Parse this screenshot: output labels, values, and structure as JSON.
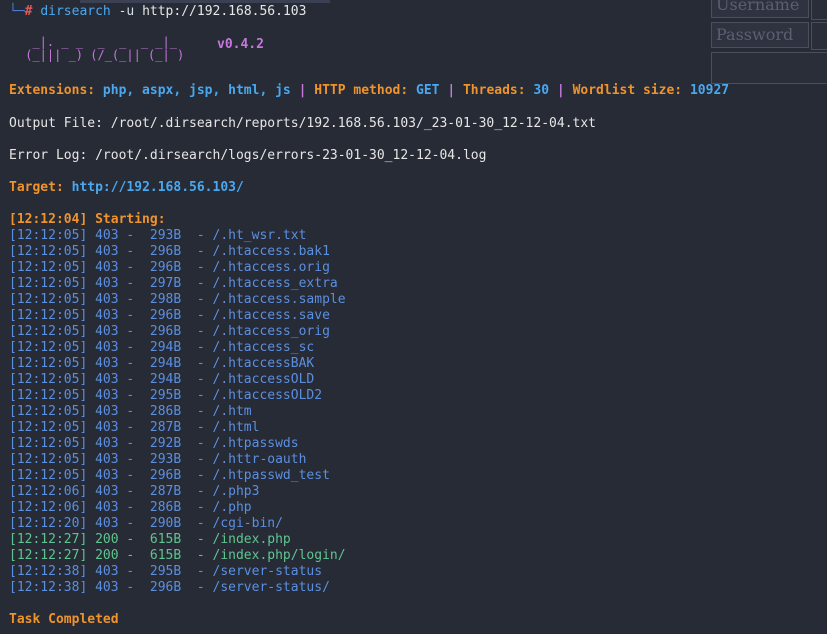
{
  "prompt": {
    "command": "dirsearch",
    "flag": "-u",
    "url": "http://192.168.56.103"
  },
  "banner": {
    "logo_line1": "  _|. _ _  _  _  _ _|_",
    "logo_line2": " (_||| _) (/_(_|| (_| )",
    "version": "v0.4.2"
  },
  "config": {
    "extensions_label": "Extensions:",
    "extensions_value": "php, aspx, jsp, html, js",
    "method_label": "HTTP method:",
    "method_value": "GET",
    "threads_label": "Threads:",
    "threads_value": "30",
    "wordlist_label": "Wordlist size:",
    "wordlist_value": "10927",
    "separator": "|"
  },
  "output_file": "Output File: /root/.dirsearch/reports/192.168.56.103/_23-01-30_12-12-04.txt",
  "error_log": "Error Log: /root/.dirsearch/logs/errors-23-01-30_12-12-04.log",
  "target": {
    "label": "Target:",
    "url": "http://192.168.56.103/"
  },
  "starting": "[12:12:04] Starting:",
  "results": [
    {
      "text": "[12:12:05] 403 -  293B  - /.ht_wsr.txt",
      "status": "403"
    },
    {
      "text": "[12:12:05] 403 -  296B  - /.htaccess.bak1",
      "status": "403"
    },
    {
      "text": "[12:12:05] 403 -  296B  - /.htaccess.orig",
      "status": "403"
    },
    {
      "text": "[12:12:05] 403 -  297B  - /.htaccess_extra",
      "status": "403"
    },
    {
      "text": "[12:12:05] 403 -  298B  - /.htaccess.sample",
      "status": "403"
    },
    {
      "text": "[12:12:05] 403 -  296B  - /.htaccess.save",
      "status": "403"
    },
    {
      "text": "[12:12:05] 403 -  296B  - /.htaccess_orig",
      "status": "403"
    },
    {
      "text": "[12:12:05] 403 -  294B  - /.htaccess_sc",
      "status": "403"
    },
    {
      "text": "[12:12:05] 403 -  294B  - /.htaccessBAK",
      "status": "403"
    },
    {
      "text": "[12:12:05] 403 -  294B  - /.htaccessOLD",
      "status": "403"
    },
    {
      "text": "[12:12:05] 403 -  295B  - /.htaccessOLD2",
      "status": "403"
    },
    {
      "text": "[12:12:05] 403 -  286B  - /.htm",
      "status": "403"
    },
    {
      "text": "[12:12:05] 403 -  287B  - /.html",
      "status": "403"
    },
    {
      "text": "[12:12:05] 403 -  292B  - /.htpasswds",
      "status": "403"
    },
    {
      "text": "[12:12:05] 403 -  293B  - /.httr-oauth",
      "status": "403"
    },
    {
      "text": "[12:12:05] 403 -  296B  - /.htpasswd_test",
      "status": "403"
    },
    {
      "text": "[12:12:06] 403 -  287B  - /.php3",
      "status": "403"
    },
    {
      "text": "[12:12:06] 403 -  286B  - /.php",
      "status": "403"
    },
    {
      "text": "[12:12:20] 403 -  290B  - /cgi-bin/",
      "status": "403"
    },
    {
      "text": "[12:12:27] 200 -  615B  - /index.php",
      "status": "200"
    },
    {
      "text": "[12:12:27] 200 -  615B  - /index.php/login/",
      "status": "200"
    },
    {
      "text": "[12:12:38] 403 -  295B  - /server-status",
      "status": "403"
    },
    {
      "text": "[12:12:38] 403 -  296B  - /server-status/",
      "status": "403"
    }
  ],
  "task_completed": "Task Completed",
  "login_form": {
    "username_placeholder": "Username",
    "password_placeholder": "Password"
  },
  "colors": {
    "background": "#262b36",
    "orange": "#f0932b",
    "blue": "#4aa8f0",
    "purple": "#c678dd",
    "status_403": "#5b8fe0",
    "status_200": "#5fc58f"
  }
}
